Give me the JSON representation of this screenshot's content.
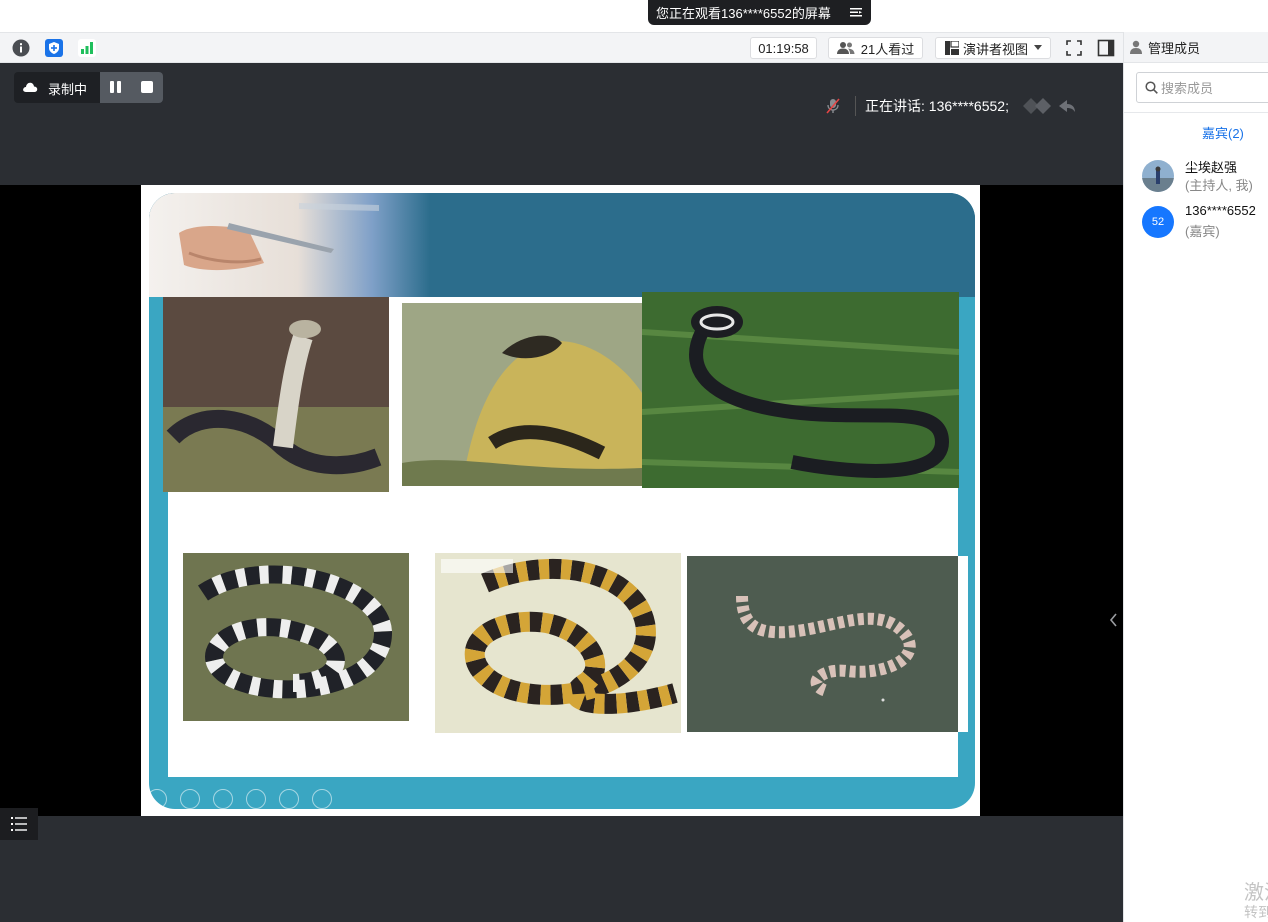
{
  "banner": {
    "text": "您正在观看136****6552的屏幕"
  },
  "toolbar": {
    "timer": "01:19:58",
    "viewers": "21人看过",
    "view_mode": "演讲者视图"
  },
  "recording": {
    "label": "录制中"
  },
  "speaking": {
    "text": "正在讲话: 136****6552;"
  },
  "panel": {
    "title": "管理成员",
    "search_placeholder": "搜索成员",
    "guests_label": "嘉宾(2)",
    "members": [
      {
        "name": "尘埃赵强",
        "role": "(主持人, 我)"
      },
      {
        "name": "136****6552",
        "role": "(嘉宾)",
        "avatar_text": "52"
      }
    ]
  },
  "watermark": {
    "line1": "激活",
    "line2": "转到"
  },
  "colors": {
    "accent_blue": "#1a73e8",
    "avatar_blue": "#1677ff",
    "slide_teal": "#3aa6c2",
    "slide_header": "#2c6d8c",
    "signal_green": "#1fbf5c"
  }
}
